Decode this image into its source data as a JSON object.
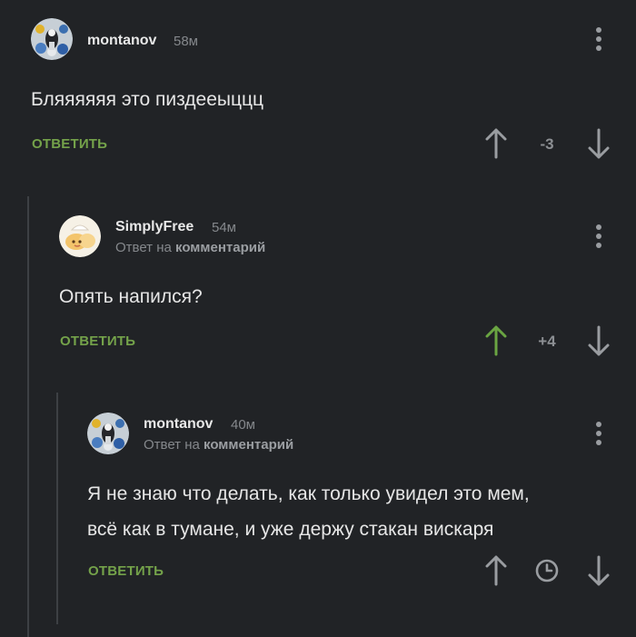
{
  "comments": [
    {
      "username": "montanov",
      "time": "58м",
      "text_lines": [
        "Бляяяяяя это пиздееыццц"
      ],
      "reply_label": "ОТВЕТИТЬ",
      "score": "-3",
      "upvoted": false
    },
    {
      "username": "SimplyFree",
      "time": "54м",
      "reply_prefix": "Ответ на",
      "reply_target": "комментарий",
      "text_lines": [
        "Опять напился?"
      ],
      "reply_label": "ОТВЕТИТЬ",
      "score": "+4",
      "upvoted": true
    },
    {
      "username": "montanov",
      "time": "40м",
      "reply_prefix": "Ответ на",
      "reply_target": "комментарий",
      "text_lines": [
        "Я не знаю что делать, как только увидел это мем,",
        "всё как в тумане, и уже держу стакан вискаря"
      ],
      "reply_label": "ОТВЕТИТЬ",
      "score_pending": true
    }
  ],
  "colors": {
    "background": "#212326",
    "accent_green": "#74a24a",
    "upvote_active": "#6aa542",
    "muted_text": "#85888c",
    "thread_line": "#3d4044"
  },
  "icons": [
    "arrow-up-icon",
    "arrow-down-icon",
    "more-vertical-icon",
    "clock-icon"
  ]
}
